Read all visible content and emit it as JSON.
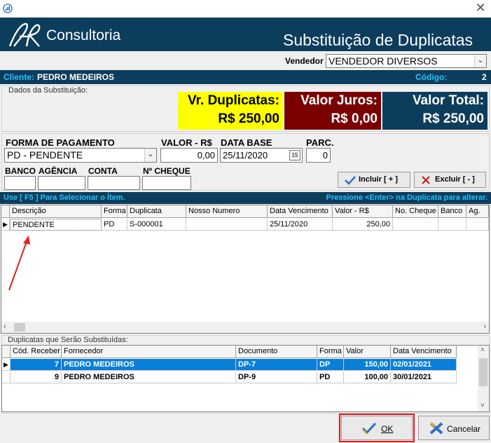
{
  "window": {
    "close_glyph": "✕"
  },
  "header": {
    "brand": "Consultoria",
    "title": "Substituição de Duplicatas"
  },
  "vendor": {
    "label": "Vendedor",
    "value": "VENDEDOR DIVERSOS"
  },
  "client_bar": {
    "client_label": "Cliente:",
    "client_name": "PEDRO MEDEIROS",
    "code_label": "Código:",
    "code_value": "2"
  },
  "substitution": {
    "group_label": "Dados da Substituição:",
    "duplicatas_label": "Vr. Duplicatas:",
    "duplicatas_value": "R$ 250,00",
    "juros_label": "Valor Juros:",
    "juros_value": "R$ 0,00",
    "total_label": "Valor Total:",
    "total_value": "R$ 250,00",
    "colors": {
      "yellow": "#ffff00",
      "maroon": "#7a0000",
      "navy": "#0d3d5c"
    }
  },
  "payment": {
    "forma_label": "FORMA DE PAGAMENTO",
    "forma_value": "PD - PENDENTE",
    "valor_label": "VALOR - R$",
    "valor_value": "0,00",
    "database_label": "DATA BASE",
    "database_value": "25/11/2020",
    "calendar_text": "15",
    "parc_label": "PARC.",
    "parc_value": "0",
    "banco_label": "BANCO",
    "agencia_label": "AGÊNCIA",
    "conta_label": "CONTA",
    "cheque_label": "Nº CHEQUE",
    "incluir_label": "Incluir [ + ]",
    "excluir_label": "Excluir [ - ]"
  },
  "instruction_bar": {
    "left": "Use [ F5 ] Para Selecionar o Ítem.",
    "right": "Pressione <Enter> na Duplicata para alterar."
  },
  "grid1": {
    "headers": [
      "Descrição",
      "Forma",
      "Duplicata",
      "Nosso Numero",
      "Data Vencimento",
      "Valor - R$",
      "No. Cheque",
      "Banco",
      "Ag."
    ],
    "rows": [
      {
        "descricao": "PENDENTE",
        "forma": "PD",
        "duplicata": "S-000001",
        "nosso_numero": "",
        "vencimento": "25/11/2020",
        "valor": "250,00"
      }
    ]
  },
  "grid2": {
    "group_label": "Duplicatas que Serão Substituídas:",
    "headers": [
      "Cód. Receber",
      "Fornecedor",
      "Documento",
      "Forma",
      "Valor",
      "Data Vencimento"
    ],
    "rows": [
      {
        "cod": "7",
        "fornecedor": "PEDRO MEDEIROS",
        "documento": "DP-7",
        "forma": "DP",
        "valor": "150,00",
        "vencimento": "02/01/2021"
      },
      {
        "cod": "9",
        "fornecedor": "PEDRO MEDEIROS",
        "documento": "DP-9",
        "forma": "PD",
        "valor": "100,00",
        "vencimento": "30/01/2021"
      }
    ]
  },
  "footer": {
    "ok_label": "OK",
    "cancel_label": "Cancelar"
  }
}
